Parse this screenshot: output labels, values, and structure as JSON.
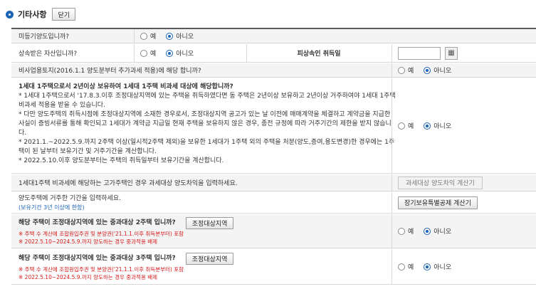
{
  "section": {
    "title": "기타사항",
    "close_label": "닫기"
  },
  "radio": {
    "yes": "예",
    "no": "아니오"
  },
  "rows": {
    "unregistered": {
      "label": "미등기양도입니까?",
      "selected": "no"
    },
    "inherited": {
      "label": "상속받은 자산입니까?",
      "selected": "no",
      "decedent_label": "피상속인 취득일",
      "decedent_date_value": ""
    },
    "nonbusiness_land": {
      "label": "비사업용토지(2016.1.1 양도분부터 추가과세 적용)에 해당 합니까?",
      "selected": "no"
    },
    "one_household": {
      "lines": [
        "1세대 1주택으로서 2년이상 보유하여 1세대 1주택 비과세 대상에 해당합니까?",
        "* 1세대 1주택으로서 '17.8.3.이후 조정대상지역에 있는 주택을 취득하였다면 동 주택은 2년이상 보유하고 2년이상 거주하여야 1세대 1주택 비과세 적용을 받을 수 있습니다.",
        "* 다만 양도주택의 취득시점에 조정대상지역에 소재한 경우로서, 조정대상지역 공고가 있는 날 이전에 매매계약을 체결하고 계약금을 지급한 사실이 증빙서류를 통해 확인되고 1세대가 계약금 지급일 현재 주택을 보유하지 않은 경우, 종전 규정에 따라 거주기간의 제한을 받지 않습니다.",
        "* 2021.1.~2022.5.9.까지 2주택 이상(일시적2주택 제외)을 보유한 1세대가 1주택 외의 주택을 처분(양도,증여,용도변경)한 경우에는 1주택이 된 날부터 보유기간 및 거주기간을 계산합니다.",
        "* 2022.5.10.이후 양도분부터는 주택의 취득일부터 보유기간을 계산합니다."
      ],
      "selected": "no"
    },
    "luxury_house": {
      "label": "1세대1주택 비과세에 해당하는 고가주택인 경우 과세대상 양도차익을 입력하세요.",
      "button": "과세대상 양도차익 계산기"
    },
    "residence_period": {
      "label": "양도주택에 거주한 기간을 입력하세요.",
      "note": "(보유기간 3년 이상에 한함)",
      "button": "장기보유특별공제 계산기"
    },
    "adjusted_2house": {
      "label": "해당 주택이 조정대상지역에 있는 중과대상 2주택 입니까?",
      "button": "조정대상지역",
      "notes": [
        "※ 주택 수 계산에 조합원입주권 및 분양권('21.1.1.이후 취득분부터) 포함",
        "※ 2022.5.10~2024.5.9.까지 양도하는 경우 중과적용 배제"
      ],
      "selected": "no"
    },
    "adjusted_3house": {
      "label": "해당 주택이 조정대상지역에 있는 중과대상 3주택 입니까?",
      "button": "조정대상지역",
      "notes": [
        "※ 주택 수 계산에 조합원입주권 및 분양권('21.1.1.이후 취득분부터) 포함",
        "※ 2022.5.10~2024.5.9.까지 양도하는 경우 중과적용 배제"
      ],
      "selected": "no"
    }
  },
  "icons": {
    "section_bullet": "circle-bullet-icon",
    "calendar": "calendar-icon"
  },
  "colors": {
    "accent": "#1a64b5",
    "warning": "#d41a1a",
    "row_shade": "#f4f4f4"
  }
}
